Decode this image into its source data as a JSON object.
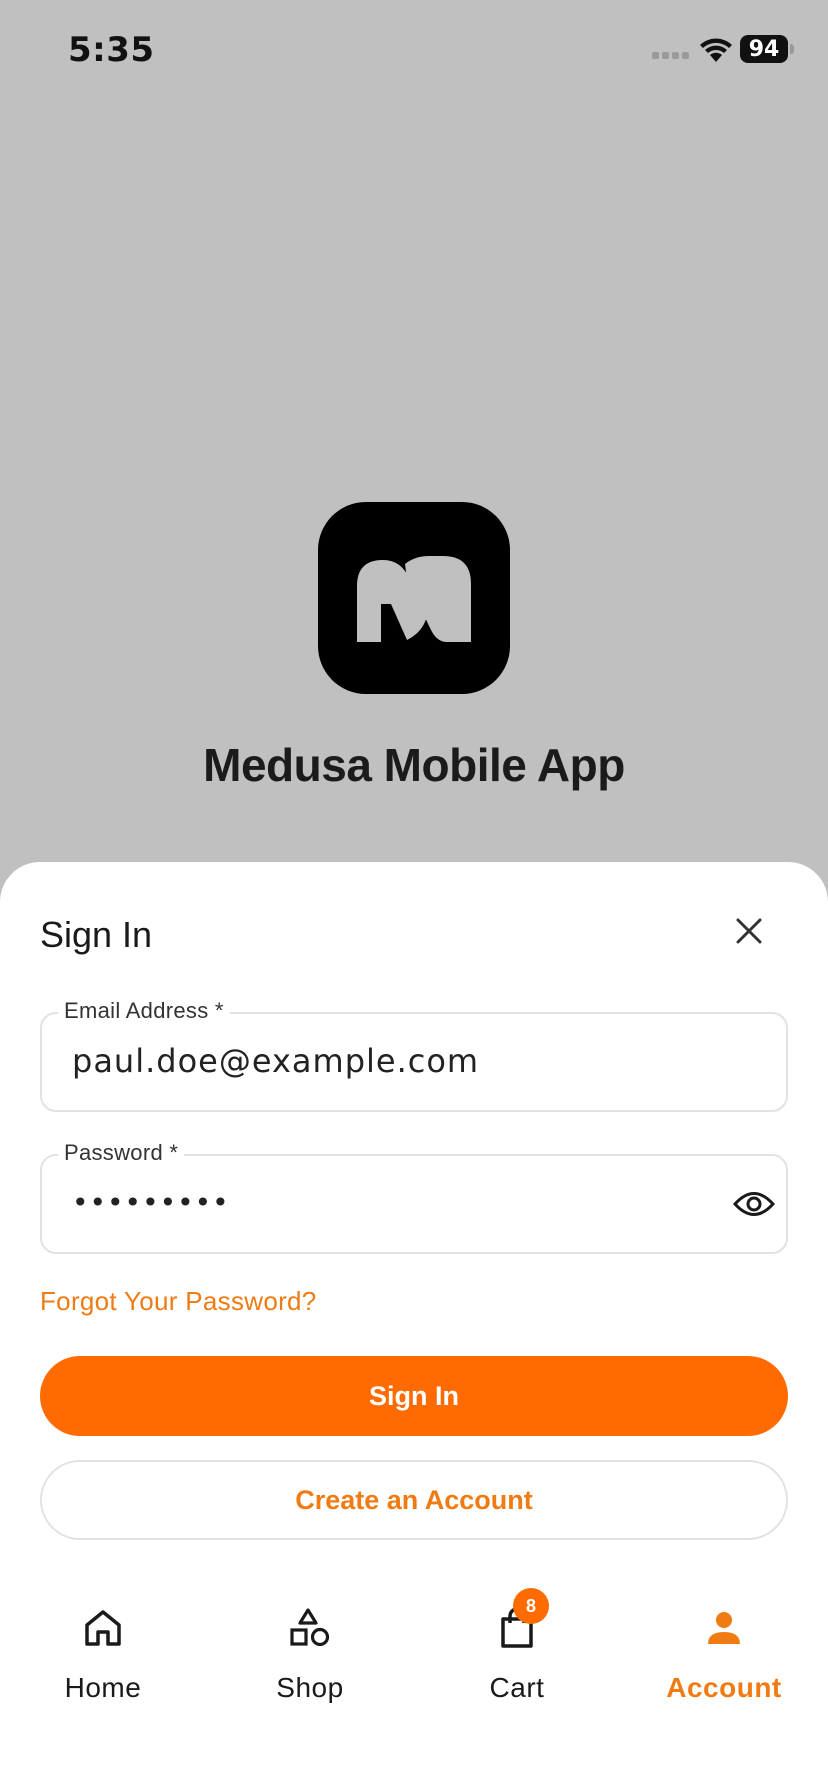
{
  "status": {
    "time": "5:35",
    "battery": "94"
  },
  "brand": {
    "app_title": "Medusa Mobile App"
  },
  "sheet": {
    "title": "Sign In",
    "email": {
      "label": "Email Address *",
      "value": "paul.doe@example.com"
    },
    "password": {
      "label": "Password *",
      "value": "•••••••••"
    },
    "forgot_label": "Forgot Your Password?",
    "sign_in_label": "Sign In",
    "create_account_label": "Create an Account"
  },
  "tabbar": {
    "items": [
      {
        "label": "Home",
        "icon": "home-icon"
      },
      {
        "label": "Shop",
        "icon": "shapes-icon"
      },
      {
        "label": "Cart",
        "icon": "shopping-bag-icon",
        "badge": "8"
      },
      {
        "label": "Account",
        "icon": "person-icon",
        "active": true
      }
    ]
  },
  "colors": {
    "accent": "#ff6b00",
    "accent_text": "#f07b13",
    "backdrop": "#c0c0c0",
    "logo_bg": "#000000"
  }
}
